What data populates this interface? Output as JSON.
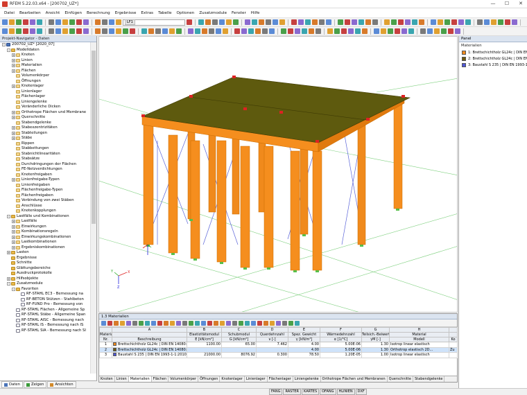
{
  "window": {
    "title": "RFEM 5.22.03.x64 - [200702_UZ*]"
  },
  "menu": [
    "Datei",
    "Bearbeiten",
    "Ansicht",
    "Einfügen",
    "Berechnung",
    "Ergebnisse",
    "Extras",
    "Tabelle",
    "Optionen",
    "Zusatzmodule",
    "Fenster",
    "Hilfe"
  ],
  "toolbar": {
    "loadcase_tag": "LF1",
    "loadcase_value": ""
  },
  "navigator": {
    "title": "Projekt-Navigator - Daten",
    "items": [
      {
        "level": 0,
        "exp": "-",
        "icon": "model",
        "label": "200702_UZ* [2020_07]"
      },
      {
        "level": 1,
        "exp": "-",
        "icon": "folder",
        "label": "Modelldaten"
      },
      {
        "level": 2,
        "exp": "+",
        "icon": "item",
        "label": "Knoten"
      },
      {
        "level": 2,
        "exp": "+",
        "icon": "item",
        "label": "Linien"
      },
      {
        "level": 2,
        "exp": "+",
        "icon": "item",
        "label": "Materialien"
      },
      {
        "level": 2,
        "exp": "+",
        "icon": "item",
        "label": "Flächen"
      },
      {
        "level": 2,
        "exp": "",
        "icon": "item",
        "label": "Volumenkörper"
      },
      {
        "level": 2,
        "exp": "",
        "icon": "item",
        "label": "Öffnungen"
      },
      {
        "level": 2,
        "exp": "+",
        "icon": "item",
        "label": "Knotenlager"
      },
      {
        "level": 2,
        "exp": "",
        "icon": "item",
        "label": "Linienlager"
      },
      {
        "level": 2,
        "exp": "",
        "icon": "item",
        "label": "Flächenlager"
      },
      {
        "level": 2,
        "exp": "",
        "icon": "item",
        "label": "Liniengelenke"
      },
      {
        "level": 2,
        "exp": "",
        "icon": "item",
        "label": "Veränderliche Dicken"
      },
      {
        "level": 2,
        "exp": "+",
        "icon": "item",
        "label": "Orthotrope Flächen und Membrane"
      },
      {
        "level": 2,
        "exp": "+",
        "icon": "item",
        "label": "Querschnitte"
      },
      {
        "level": 2,
        "exp": "",
        "icon": "item",
        "label": "Stabendgelenke"
      },
      {
        "level": 2,
        "exp": "+",
        "icon": "item",
        "label": "Stabexzentrizitäten"
      },
      {
        "level": 2,
        "exp": "+",
        "icon": "item",
        "label": "Stabteilungen"
      },
      {
        "level": 2,
        "exp": "+",
        "icon": "item",
        "label": "Stäbe"
      },
      {
        "level": 2,
        "exp": "",
        "icon": "item",
        "label": "Rippen"
      },
      {
        "level": 2,
        "exp": "",
        "icon": "item",
        "label": "Stabbettungen"
      },
      {
        "level": 2,
        "exp": "",
        "icon": "item",
        "label": "Stabnichtlinearitäten"
      },
      {
        "level": 2,
        "exp": "",
        "icon": "item",
        "label": "Stabsätze"
      },
      {
        "level": 2,
        "exp": "",
        "icon": "item",
        "label": "Durchdringungen der Flächen"
      },
      {
        "level": 2,
        "exp": "",
        "icon": "item",
        "label": "FE-Netzverdichtungen"
      },
      {
        "level": 2,
        "exp": "",
        "icon": "item",
        "label": "Knotenfreigaben"
      },
      {
        "level": 2,
        "exp": "+",
        "icon": "item",
        "label": "Linienfreigabe-Typen"
      },
      {
        "level": 2,
        "exp": "",
        "icon": "item",
        "label": "Linienfreigaben"
      },
      {
        "level": 2,
        "exp": "",
        "icon": "item",
        "label": "Flächenfreigabe-Typen"
      },
      {
        "level": 2,
        "exp": "",
        "icon": "item",
        "label": "Flächenfreigaben"
      },
      {
        "level": 2,
        "exp": "",
        "icon": "item",
        "label": "Verbindung von zwei Stäben"
      },
      {
        "level": 2,
        "exp": "",
        "icon": "item",
        "label": "Anschlüsse"
      },
      {
        "level": 2,
        "exp": "",
        "icon": "item",
        "label": "Knotenkopplungen"
      },
      {
        "level": 1,
        "exp": "-",
        "icon": "folder",
        "label": "Lastfälle und Kombinationen"
      },
      {
        "level": 2,
        "exp": "+",
        "icon": "item",
        "label": "Lastfälle"
      },
      {
        "level": 2,
        "exp": "+",
        "icon": "item",
        "label": "Einwirkungen"
      },
      {
        "level": 2,
        "exp": "+",
        "icon": "item",
        "label": "Kombinationsregeln"
      },
      {
        "level": 2,
        "exp": "+",
        "icon": "item",
        "label": "Einwirkungskombinationen"
      },
      {
        "level": 2,
        "exp": "+",
        "icon": "item",
        "label": "Lastkombinationen"
      },
      {
        "level": 2,
        "exp": "+",
        "icon": "item",
        "label": "Ergebniskombinationen"
      },
      {
        "level": 1,
        "exp": "+",
        "icon": "folder",
        "label": "Lasten"
      },
      {
        "level": 1,
        "exp": "",
        "icon": "folder",
        "label": "Ergebnisse"
      },
      {
        "level": 1,
        "exp": "",
        "icon": "folder",
        "label": "Schnitte"
      },
      {
        "level": 1,
        "exp": "",
        "icon": "folder",
        "label": "Glättungsbereiche"
      },
      {
        "level": 1,
        "exp": "",
        "icon": "folder",
        "label": "Ausdruckprotokolle"
      },
      {
        "level": 1,
        "exp": "+",
        "icon": "folder",
        "label": "Hilfsobjekte"
      },
      {
        "level": 1,
        "exp": "-",
        "icon": "folder",
        "label": "Zusatzmodule"
      },
      {
        "level": 2,
        "exp": "-",
        "icon": "folder",
        "label": "Favoriten"
      },
      {
        "level": 3,
        "exp": "",
        "icon": "doc",
        "label": "RF-STAHL EC3 - Bemessung na"
      },
      {
        "level": 3,
        "exp": "",
        "icon": "doc",
        "label": "RF-BETON Stützen - Stahlbeton"
      },
      {
        "level": 3,
        "exp": "",
        "icon": "doc",
        "label": "RF-FUND Pro - Bemessung von"
      },
      {
        "level": 2,
        "exp": "",
        "icon": "doc",
        "label": "RF-STAHL Flächen - Allgemeine Sp"
      },
      {
        "level": 2,
        "exp": "",
        "icon": "doc",
        "label": "RF-STAHL Stäbe - Allgemeine Span"
      },
      {
        "level": 2,
        "exp": "",
        "icon": "doc",
        "label": "RF-STAHL AISC - Bemessung nach"
      },
      {
        "level": 2,
        "exp": "",
        "icon": "doc",
        "label": "RF-STAHL IS - Bemessung nach IS"
      },
      {
        "level": 2,
        "exp": "",
        "icon": "doc",
        "label": "RF-STAHL SIA - Bemessung nach SI"
      }
    ],
    "tabs": [
      "Daten",
      "Zeigen",
      "Ansichten"
    ]
  },
  "panel": {
    "title": "Panel",
    "subtitle": "Materialien",
    "legend": [
      {
        "color": "#f08a1c",
        "label": "1: Brettschichtholz GL24c | DIN EN"
      },
      {
        "color": "#6e5a10",
        "label": "2: Brettschichtholz GL24c | DIN EN"
      },
      {
        "color": "#4f57d8",
        "label": "3: Baustahl S 235 | DIN EN 1993-1"
      }
    ]
  },
  "viewport": {
    "axis_x": "X",
    "axis_y": "Y",
    "axis_z": "Z"
  },
  "table": {
    "title": "1.3 Materialien",
    "letters": [
      "A",
      "B",
      "C",
      "D",
      "E",
      "F",
      "G",
      "H"
    ],
    "header2": [
      "Material",
      "Elastizitätsmodul",
      "Schubmodul",
      "Querdehnzahl",
      "Spez. Gewicht",
      "Wärmedehnzahl",
      "Teilsich.-Beiwert",
      "Material"
    ],
    "header3": [
      "Nr.",
      "Beschreibung",
      "E [kN/cm²]",
      "G [kN/cm²]",
      "ν [-]",
      "γ [kN/m³]",
      "α [1/°C]",
      "γM [-]",
      "Modell",
      "Ko"
    ],
    "rows": [
      {
        "nr": "1",
        "color": "#f08a1c",
        "desc": "Brettschichtholz GL24c | DIN EN 14080:2",
        "e": "1100.00",
        "g": "65.00",
        "nu": "7.462",
        "gamma": "4.00",
        "alpha": "5.00E-06",
        "gm": "1.30",
        "model": "Isotrop linear elastisch",
        "ko": ""
      },
      {
        "nr": "2",
        "color": "#6e5a10",
        "desc": "Brettschichtholz GL24c | DIN EN 14080:(X)",
        "e": "",
        "g": "",
        "nu": "",
        "gamma": "4.00",
        "alpha": "5.00E-06",
        "gm": "1.30",
        "model": "Orthotrop elastisch 2D...",
        "ko": "Zu"
      },
      {
        "nr": "3",
        "color": "#4f57d8",
        "desc": "Baustahl S 235 | DIN EN 1993-1-1:2010-1",
        "e": "21000.00",
        "g": "8076.92",
        "nu": "0.300",
        "gamma": "78.50",
        "alpha": "1.20E-05",
        "gm": "1.00",
        "model": "Isotrop linear elastisch",
        "ko": ""
      }
    ],
    "tabs": [
      "Knoten",
      "Linien",
      "Materialien",
      "Flächen",
      "Volumenkörper",
      "Öffnungen",
      "Knotenlager",
      "Linienlager",
      "Flächenlager",
      "Liniengelenke",
      "Orthotrope Flächen und Membranen",
      "Querschnitte",
      "Stabendgelenke"
    ]
  },
  "statusbar": [
    "FANG",
    "RASTER",
    "KARTES",
    "OFANG",
    "HLINIEN",
    "DXF"
  ],
  "colors": {
    "timber": "#f08a1c",
    "timber_dark": "#d06c00",
    "slab": "#5e5a0e",
    "steel": "#4f57d8"
  }
}
